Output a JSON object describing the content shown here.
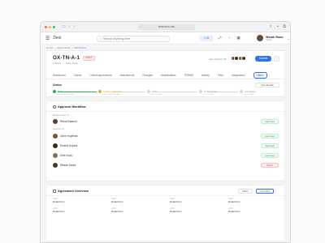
{
  "browser": {
    "url": "www.dexi.com"
  },
  "app": {
    "brand": "Dexi",
    "search_placeholder": "Search anything here",
    "ai_label": "AI"
  },
  "user": {
    "name": "Wezah Rono",
    "role": "Admin"
  },
  "breadcrumb": [
    "Home",
    "Agreements",
    "OX-TN-A-1"
  ],
  "document": {
    "title": "OX-TN-A-1",
    "status_badge": "DRAFT",
    "meta": [
      "Created",
      "Entity Name"
    ],
    "last_edited": "Last edited by 28",
    "submit_label": "Submit",
    "more_label": "⋮"
  },
  "tabs": [
    "Dashboard",
    "Claims",
    "Linked agreements",
    "Attachments",
    "Changes",
    "Modifications",
    "TERMS",
    "Activity",
    "Fees",
    "Integrations",
    "Status"
  ],
  "status_section": {
    "label": "Status",
    "view_details": "View Details",
    "steps": [
      {
        "label": "Draft",
        "state": "done",
        "date": "Jun 12, 2025 9:30 AM"
      },
      {
        "label": "Awaiting Approval",
        "state": "current",
        "date": "Jun 12, 2025 9:30 AM"
      },
      {
        "label": "Active",
        "state": "pending",
        "date": "Jun 12, 2025"
      },
      {
        "label": "In Clearance",
        "state": "pending",
        "date": "Jun 12, 2025"
      },
      {
        "label": "Completed",
        "state": "pending",
        "date": "Jun 12, 2025"
      }
    ]
  },
  "workflow": {
    "title": "Approval Workflow",
    "budget_owner_label": "Budget Owner To",
    "budget_owner": {
      "name": "Rahul Kawood",
      "status": "Approved"
    },
    "approver_label": "Approver To",
    "approvers": [
      {
        "name": "Gene Hopelma",
        "status": "Approved",
        "color": "#7a5238"
      },
      {
        "name": "Emerid Hopers",
        "status": "Approved",
        "color": "#3b2a22"
      },
      {
        "name": "Dimi Sulyu",
        "status": "Approved",
        "color": "#8a6a4e"
      },
      {
        "name": "Wezah Sartor",
        "status": "Reject",
        "color": "#4a3428"
      }
    ],
    "budget_owner_color": "#5e3c2a"
  },
  "overview": {
    "title": "Agreement Overview",
    "filter_label": "Filters",
    "view_more_label": "View More",
    "rows": [
      [
        {
          "label": "Label",
          "value": "Detail Item"
        },
        {
          "label": "Label",
          "value": "Detail Item"
        },
        {
          "label": "Label",
          "value": "Detail Item"
        },
        {
          "label": "Label",
          "value": "Detail Item"
        }
      ],
      [
        {
          "label": "Label",
          "value": "Detail Item"
        },
        {
          "label": "Label",
          "value": "Detail Item"
        },
        {
          "label": "Label",
          "value": "Detail Item"
        },
        {
          "label": "Label",
          "value": "Detail Item"
        }
      ]
    ]
  }
}
